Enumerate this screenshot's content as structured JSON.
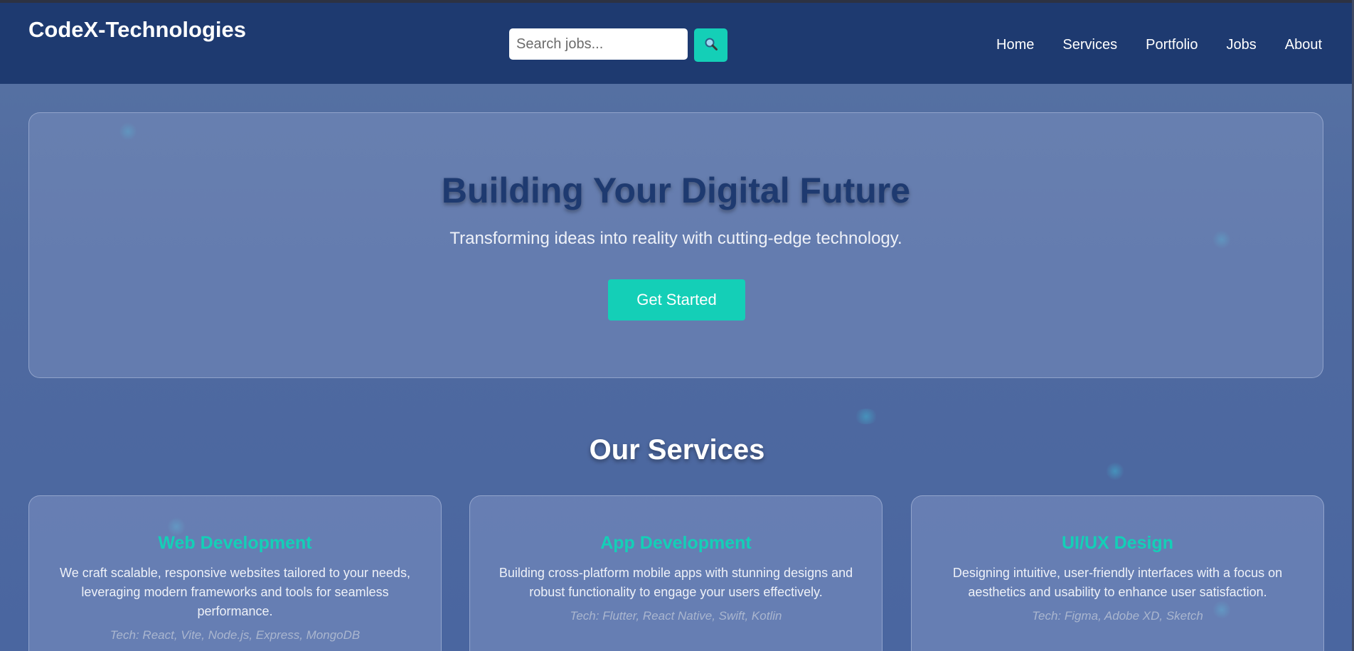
{
  "header": {
    "brand": "CodeX-Technologies",
    "search_placeholder": "Search jobs...",
    "search_icon": "magnifier-icon",
    "nav": [
      {
        "label": "Home"
      },
      {
        "label": "Services"
      },
      {
        "label": "Portfolio"
      },
      {
        "label": "Jobs"
      },
      {
        "label": "About"
      }
    ]
  },
  "hero": {
    "title": "Building Your Digital Future",
    "subtitle": "Transforming ideas into reality with cutting-edge technology.",
    "cta_label": "Get Started"
  },
  "services": {
    "title": "Our Services",
    "cards": [
      {
        "title": "Web Development",
        "description": "We craft scalable, responsive websites tailored to your needs, leveraging modern frameworks and tools for seamless performance.",
        "tech": "Tech: React, Vite, Node.js, Express, MongoDB"
      },
      {
        "title": "App Development",
        "description": "Building cross-platform mobile apps with stunning designs and robust functionality to engage your users effectively.",
        "tech": "Tech: Flutter, React Native, Swift, Kotlin"
      },
      {
        "title": "UI/UX Design",
        "description": "Designing intuitive, user-friendly interfaces with a focus on aesthetics and usability to enhance user satisfaction.",
        "tech": "Tech: Figma, Adobe XD, Sketch"
      }
    ]
  },
  "colors": {
    "header_bg": "#1e3a70",
    "accent": "#14cfb7",
    "page_bg": "#4f6aa0"
  }
}
